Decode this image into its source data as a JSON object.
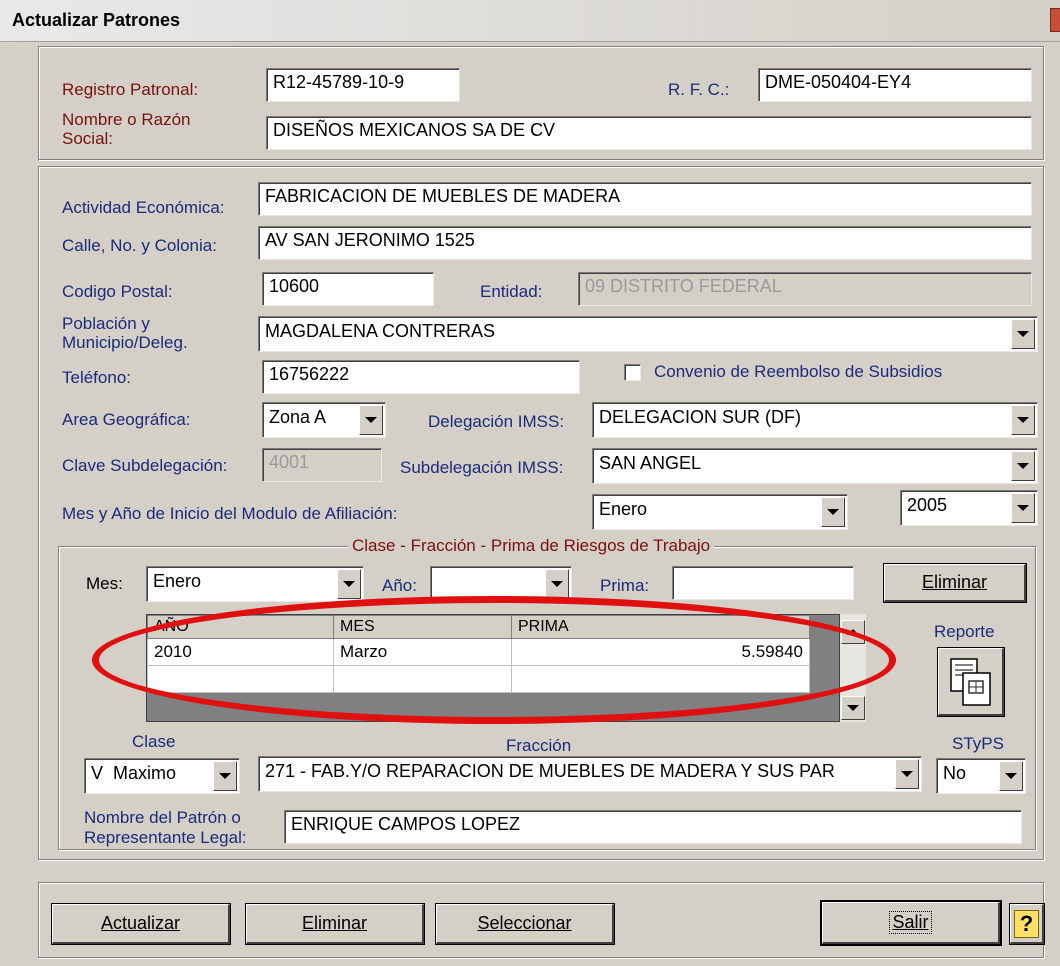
{
  "window": {
    "title": "Actualizar Patrones"
  },
  "patron": {
    "registro_label": "Registro Patronal:",
    "registro_value": "R12-45789-10-9",
    "rfc_label": "R. F. C.:",
    "rfc_value": "DME-050404-EY4",
    "nombre_label": "Nombre o Razón Social:",
    "nombre_value": "DISEÑOS MEXICANOS SA DE CV"
  },
  "detalle": {
    "actividad_label": "Actividad Económica:",
    "actividad_value": "FABRICACION DE MUEBLES DE MADERA",
    "calle_label": "Calle, No. y Colonia:",
    "calle_value": "AV SAN JERONIMO 1525",
    "cp_label": "Codigo Postal:",
    "cp_value": "10600",
    "entidad_label": "Entidad:",
    "entidad_value": "09 DISTRITO FEDERAL",
    "poblacion_label": "Población y Municipio/Deleg.",
    "poblacion_value": "MAGDALENA CONTRERAS",
    "telefono_label": "Teléfono:",
    "telefono_value": "16756222",
    "convenio_label": "Convenio de Reembolso de Subsidios",
    "area_label": "Area Geográfica:",
    "area_value": "Zona A",
    "delegacion_label": "Delegación IMSS:",
    "delegacion_value": "DELEGACION SUR (DF)",
    "clave_sub_label": "Clave Subdelegación:",
    "clave_sub_value": "4001",
    "subdelegacion_label": "Subdelegación IMSS:",
    "subdelegacion_value": "SAN ANGEL",
    "mes_anio_label": "Mes y Año de Inicio del Modulo de Afiliación:",
    "mes_value": "Enero",
    "anio_value": "2005"
  },
  "riesgos": {
    "legend": "Clase - Fracción - Prima de Riesgos de Trabajo",
    "mes_label": "Mes:",
    "mes_value": "Enero",
    "anio_label": "Año:",
    "prima_label": "Prima:",
    "eliminar_button": "Eliminar",
    "reporte_label": "Reporte",
    "columns": [
      "AÑO",
      "MES",
      "PRIMA"
    ],
    "rows": [
      [
        "2010",
        "Marzo",
        "5.59840"
      ]
    ],
    "clase_label": "Clase",
    "clase_value": "V  Maximo",
    "fraccion_label": "Fracción",
    "fraccion_value": "271 - FAB.Y/O REPARACION DE MUEBLES DE MADERA Y SUS PAR",
    "styps_label": "STyPS",
    "styps_value": "No",
    "representante_label": "Nombre del Patrón o Representante Legal:",
    "representante_value": "ENRIQUE CAMPOS LOPEZ"
  },
  "buttons": {
    "actualizar": "Actualizar",
    "eliminar": "Eliminar",
    "seleccionar": "Seleccionar",
    "salir": "Salir",
    "help": "?"
  },
  "colors": {
    "label_blue": "#1c2a7a",
    "label_red": "#7a1010",
    "highlight_ellipse": "#e01010"
  }
}
